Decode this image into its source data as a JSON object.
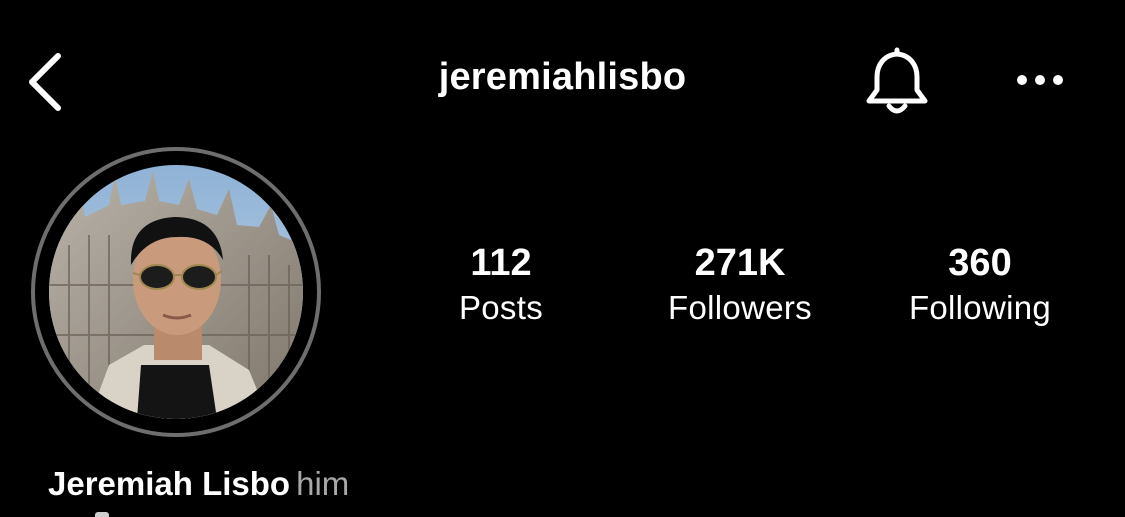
{
  "header": {
    "username": "jeremiahlisbo",
    "back_icon": "chevron-left-icon",
    "notification_icon": "bell-icon",
    "more_icon": "more-horizontal-icon"
  },
  "profile": {
    "avatar_icon": "profile-photo",
    "display_name": "Jeremiah Lisbo",
    "pronouns": "him"
  },
  "stats": {
    "posts": {
      "count": "112",
      "label": "Posts"
    },
    "followers": {
      "count": "271K",
      "label": "Followers"
    },
    "following": {
      "count": "360",
      "label": "Following"
    }
  },
  "colors": {
    "background": "#000000",
    "text": "#ffffff",
    "secondary_text": "#a8a8a8",
    "avatar_ring": "#6e6e6e"
  }
}
